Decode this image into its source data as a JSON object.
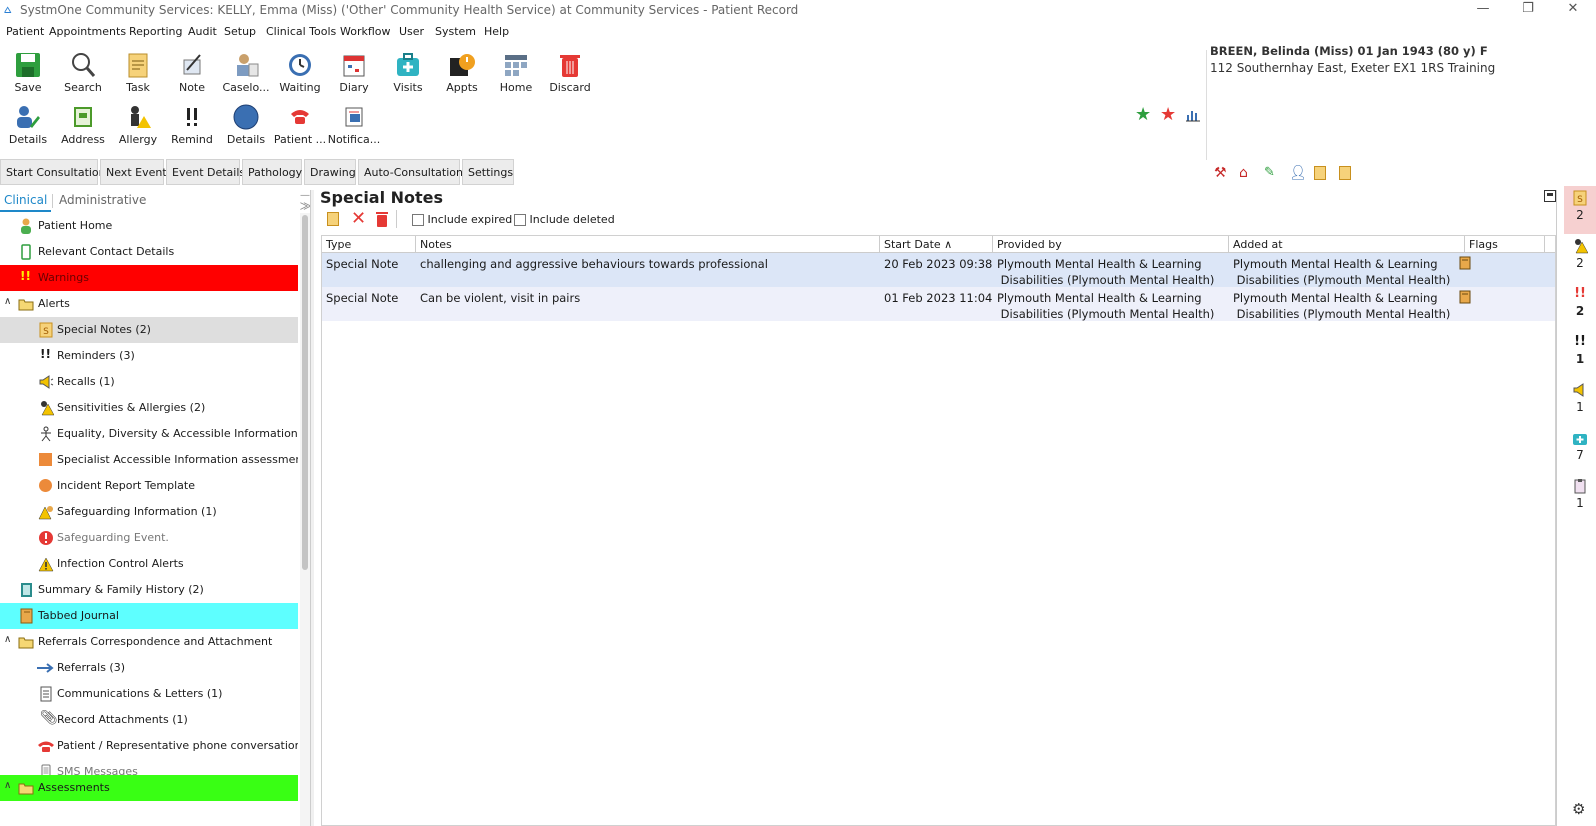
{
  "window": {
    "title": "SystmOne Community Services: KELLY, Emma (Miss) ('Other' Community Health Service) at Community Services - Patient Record"
  },
  "menu": [
    "Patient",
    "Appointments",
    "Reporting",
    "Audit",
    "Setup",
    "Clinical Tools",
    "Workflow",
    "User",
    "System",
    "Help"
  ],
  "toolbar_row1": [
    {
      "label": "Save",
      "icon": "save-icon"
    },
    {
      "label": "Search",
      "icon": "search-icon"
    },
    {
      "label": "Task",
      "icon": "task-icon"
    },
    {
      "label": "Note",
      "icon": "note-icon"
    },
    {
      "label": "Caselo...",
      "icon": "caseload-icon"
    },
    {
      "label": "Waiting",
      "icon": "waiting-icon"
    },
    {
      "label": "Diary",
      "icon": "diary-icon"
    },
    {
      "label": "Visits",
      "icon": "visits-icon"
    },
    {
      "label": "Appts",
      "icon": "appts-icon"
    },
    {
      "label": "Home",
      "icon": "home-icon"
    },
    {
      "label": "Discard",
      "icon": "discard-icon"
    }
  ],
  "toolbar_row2": [
    {
      "label": "Details",
      "icon": "details-icon"
    },
    {
      "label": "Address",
      "icon": "address-icon"
    },
    {
      "label": "Allergy",
      "icon": "allergy-icon"
    },
    {
      "label": "Remind",
      "icon": "remind-icon"
    },
    {
      "label": "Details",
      "icon": "details-circle-icon"
    },
    {
      "label": "Patient ...",
      "icon": "patient-phone-icon"
    },
    {
      "label": "Notifica...",
      "icon": "notification-icon"
    }
  ],
  "patient": {
    "name_line": "BREEN, Belinda (Miss) 01 Jan 1943 (80 y) F",
    "address_line": "112 Southernhay East, Exeter EX1 1RS  Training"
  },
  "tabs": [
    "Start Consultation",
    "Next Event",
    "Event Details",
    "Pathology",
    "Drawing",
    "Auto-Consultation",
    "Settings"
  ],
  "left_tabs": [
    "Clinical",
    "Administrative"
  ],
  "tree": [
    {
      "label": "Patient Home",
      "icon": "person-icon",
      "indent": 1
    },
    {
      "label": "Relevant Contact Details",
      "icon": "phone-icon",
      "indent": 1
    },
    {
      "label": "Warnings",
      "icon": "warning-exclaim-icon",
      "indent": 1,
      "bg": "#ff0000"
    },
    {
      "label": "Alerts",
      "icon": "folder-icon",
      "indent": 1,
      "expanded": true
    },
    {
      "label": "Special Notes (2)",
      "icon": "special-note-icon",
      "indent": 2,
      "selected": true
    },
    {
      "label": "Reminders (3)",
      "icon": "double-exclaim-icon",
      "indent": 2
    },
    {
      "label": "Recalls (1)",
      "icon": "megaphone-icon",
      "indent": 2
    },
    {
      "label": "Sensitivities & Allergies (2)",
      "icon": "allergy-warning-icon",
      "indent": 2
    },
    {
      "label": "Equality, Diversity & Accessible Information Need.",
      "icon": "stick-figure-icon",
      "indent": 2
    },
    {
      "label": "Specialist Accessible Information assessment",
      "icon": "orange-square-icon",
      "indent": 2
    },
    {
      "label": "Incident Report Template",
      "icon": "orange-circle-icon",
      "indent": 2
    },
    {
      "label": "Safeguarding Information (1)",
      "icon": "safeguarding-icon",
      "indent": 2
    },
    {
      "label": "Safeguarding Event.",
      "icon": "red-alert-circle-icon",
      "indent": 2,
      "muted": true
    },
    {
      "label": "Infection Control Alerts",
      "icon": "yellow-triangle-icon",
      "indent": 2
    },
    {
      "label": "Summary & Family History (2)",
      "icon": "summary-book-icon",
      "indent": 1
    },
    {
      "label": "Tabbed Journal",
      "icon": "journal-icon",
      "indent": 1,
      "bg": "#5effff"
    },
    {
      "label": "Referrals Correspondence and Attachment",
      "icon": "folder-icon",
      "indent": 1,
      "expanded": true
    },
    {
      "label": "Referrals (3)",
      "icon": "arrow-right-icon",
      "indent": 2
    },
    {
      "label": "Communications & Letters (1)",
      "icon": "letter-icon",
      "indent": 2
    },
    {
      "label": "Record Attachments (1)",
      "icon": "paperclip-icon",
      "indent": 2
    },
    {
      "label": "Patient / Representative phone conversation",
      "icon": "red-phone-icon",
      "indent": 2
    },
    {
      "label": "SMS Messages",
      "icon": "mobile-icon",
      "indent": 2,
      "muted": true
    },
    {
      "label": "Assessments",
      "icon": "folder-icon",
      "indent": 1,
      "expanded": true,
      "bg": "#39ff14"
    }
  ],
  "main": {
    "title": "Special Notes",
    "include_expired": "Include expired",
    "include_deleted": "Include deleted",
    "columns": [
      "Type",
      "Notes",
      "Start Date",
      "Provided by",
      "Added at",
      "Flags"
    ],
    "rows": [
      {
        "type": "Special Note",
        "notes": "challenging and aggressive behaviours towards professional",
        "start_date": "20 Feb 2023 09:38",
        "provided_by_1": "Plymouth Mental Health & Learning",
        "provided_by_2": " Disabilities (Plymouth Mental Health)",
        "added_at_1": "Plymouth Mental Health & Learning",
        "added_at_2": " Disabilities (Plymouth Mental Health)"
      },
      {
        "type": "Special Note",
        "notes": "Can be violent, visit in pairs",
        "start_date": "01 Feb 2023 11:04",
        "provided_by_1": "Plymouth Mental Health & Learning",
        "provided_by_2": " Disabilities (Plymouth Mental Health)",
        "added_at_1": "Plymouth Mental Health & Learning",
        "added_at_2": " Disabilities (Plymouth Mental Health)"
      }
    ]
  },
  "right_counts": [
    {
      "icon": "special-note-icon",
      "count": "2"
    },
    {
      "icon": "allergy-warning-icon",
      "count": "2"
    },
    {
      "icon": "red-double-exclaim-icon",
      "count": "2"
    },
    {
      "icon": "double-exclaim-icon",
      "count": "1"
    },
    {
      "icon": "megaphone-icon",
      "count": "1"
    },
    {
      "icon": "visits-icon",
      "count": "7"
    },
    {
      "icon": "clipboard-icon",
      "count": "1"
    }
  ],
  "colors": {
    "selected_row": "#dce6f7",
    "alt_row": "#eef0fa",
    "accent": "#1e88c9"
  }
}
